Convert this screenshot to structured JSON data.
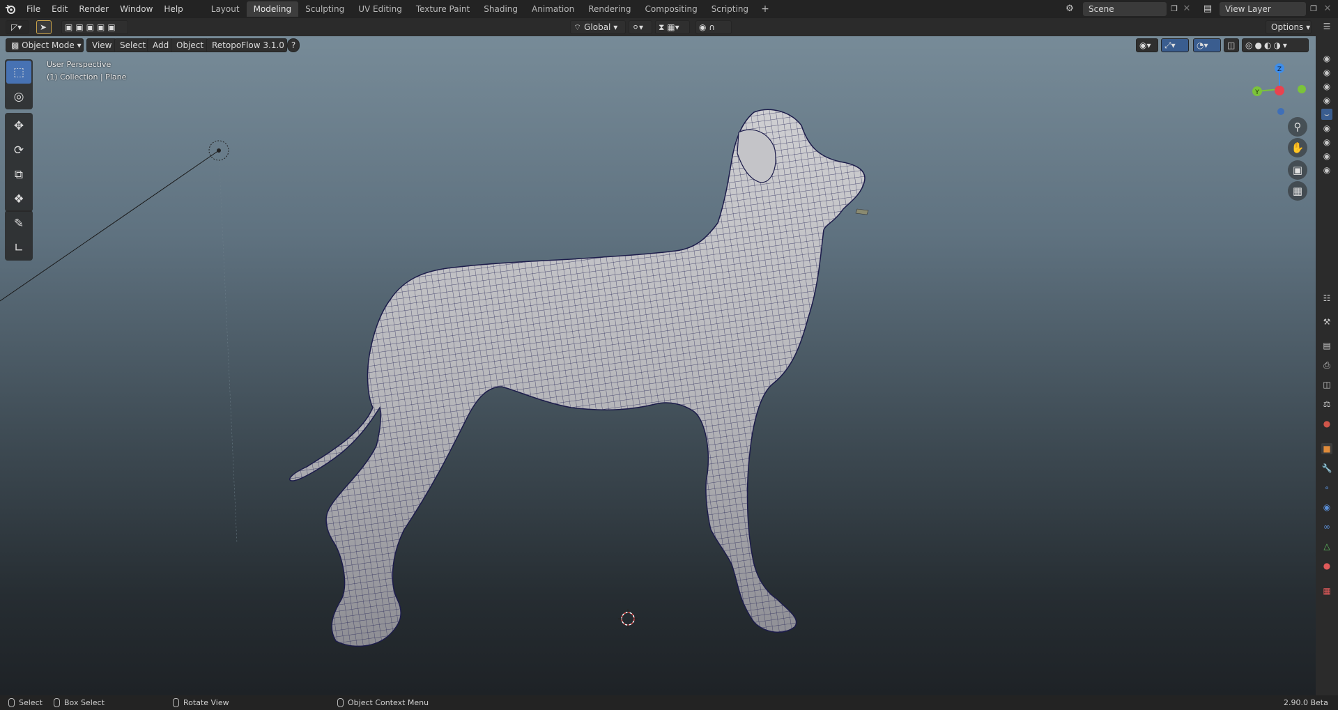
{
  "menubar": {
    "items": [
      "File",
      "Edit",
      "Render",
      "Window",
      "Help"
    ],
    "workspaces": [
      "Layout",
      "Modeling",
      "Sculpting",
      "UV Editing",
      "Texture Paint",
      "Shading",
      "Animation",
      "Rendering",
      "Compositing",
      "Scripting"
    ],
    "active_workspace": "Modeling",
    "add_tab": "+",
    "scene": "Scene",
    "view_layer": "View Layer"
  },
  "toolheader": {
    "transform_orientation": "Global",
    "options": "Options"
  },
  "viewheader": {
    "mode": "Object Mode",
    "view": "View",
    "select": "Select",
    "add": "Add",
    "object": "Object",
    "addon": "RetopoFlow 3.1.0",
    "help": "?"
  },
  "viewport": {
    "perspective": "User Perspective",
    "collection": "(1) Collection | Plane",
    "gizmo_axes": [
      "Z",
      "Y",
      "X"
    ]
  },
  "statusbar": {
    "select": "Select",
    "box_select": "Box Select",
    "rotate_view": "Rotate View",
    "context_menu": "Object Context Menu",
    "version": "2.90.0 Beta"
  },
  "colors": {
    "accent": "#4772b3",
    "x_axis": "#e8434f",
    "y_axis": "#7bc33a",
    "z_axis": "#3f8de8"
  }
}
